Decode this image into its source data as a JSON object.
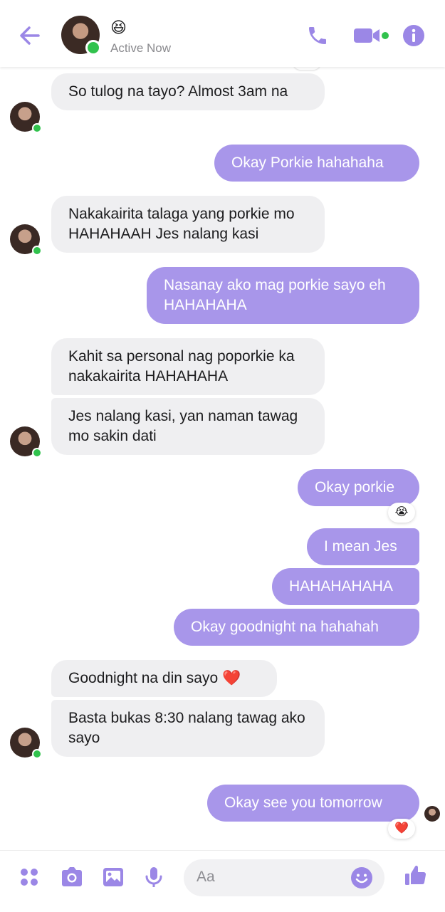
{
  "header": {
    "status_emoji": "😆",
    "status_text": "Active Now"
  },
  "messages": [
    {
      "id": 1,
      "side": "in",
      "text": "So tulog na tayo? Almost 3am na"
    },
    {
      "id": 2,
      "side": "out",
      "text": "Okay Porkie hahahaha"
    },
    {
      "id": 3,
      "side": "in",
      "text": "Nakakairita talaga yang porkie mo HAHAHAAH Jes nalang kasi"
    },
    {
      "id": 4,
      "side": "out",
      "text": "Nasanay ako mag porkie sayo eh HAHAHAHA"
    },
    {
      "id": 5,
      "side": "in",
      "text": "Kahit sa personal nag poporkie ka nakakairita HAHAHAHA"
    },
    {
      "id": 6,
      "side": "in",
      "text": "Jes nalang kasi, yan naman tawag mo sakin dati"
    },
    {
      "id": 7,
      "side": "out",
      "text": "Okay porkie",
      "reaction": "😭"
    },
    {
      "id": 8,
      "side": "out",
      "text": "I mean Jes"
    },
    {
      "id": 9,
      "side": "out",
      "text": "HAHAHAHAHA"
    },
    {
      "id": 10,
      "side": "out",
      "text": "Okay goodnight na hahahah"
    },
    {
      "id": 11,
      "side": "in",
      "text": "Goodnight na din sayo ❤️"
    },
    {
      "id": 12,
      "side": "in",
      "text": "Basta bukas 8:30 nalang tawag ako sayo"
    },
    {
      "id": 13,
      "side": "out",
      "text": "Okay see you tomorrow",
      "reaction": "❤️"
    }
  ],
  "composer": {
    "placeholder": "Aa"
  },
  "colors": {
    "accent": "#a896ea",
    "icon": "#9b87e6",
    "incoming_bubble": "#efeff1",
    "online": "#31c24d"
  }
}
